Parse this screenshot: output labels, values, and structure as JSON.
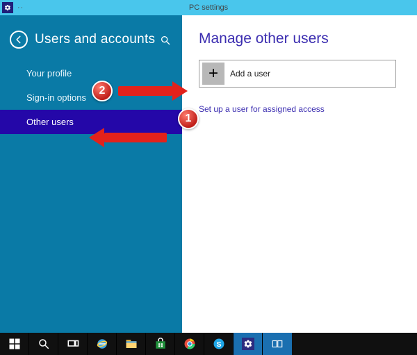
{
  "window": {
    "title": "PC settings",
    "menu_dots": "··"
  },
  "sidebar": {
    "title": "Users and accounts",
    "items": [
      {
        "label": "Your profile",
        "selected": false
      },
      {
        "label": "Sign-in options",
        "selected": false
      },
      {
        "label": "Other users",
        "selected": true
      }
    ]
  },
  "content": {
    "heading": "Manage other users",
    "add_user_label": "Add a user",
    "assigned_access_link": "Set up a user for assigned access"
  },
  "annotations": {
    "badge1": "1",
    "badge2": "2"
  },
  "taskbar": {
    "items": [
      {
        "name": "start",
        "active": false
      },
      {
        "name": "search",
        "active": false
      },
      {
        "name": "task-view",
        "active": false
      },
      {
        "name": "ie",
        "active": false
      },
      {
        "name": "file-explorer",
        "active": false
      },
      {
        "name": "store",
        "active": false
      },
      {
        "name": "chrome",
        "active": false
      },
      {
        "name": "skype",
        "active": false
      },
      {
        "name": "pc-settings",
        "active": true
      },
      {
        "name": "app-group",
        "active": true
      }
    ]
  },
  "colors": {
    "accent": "#0a7aa6",
    "selected": "#2407a8",
    "heading": "#3b2db0",
    "annotation": "#e2221b",
    "titlebar": "#49c6ec"
  }
}
